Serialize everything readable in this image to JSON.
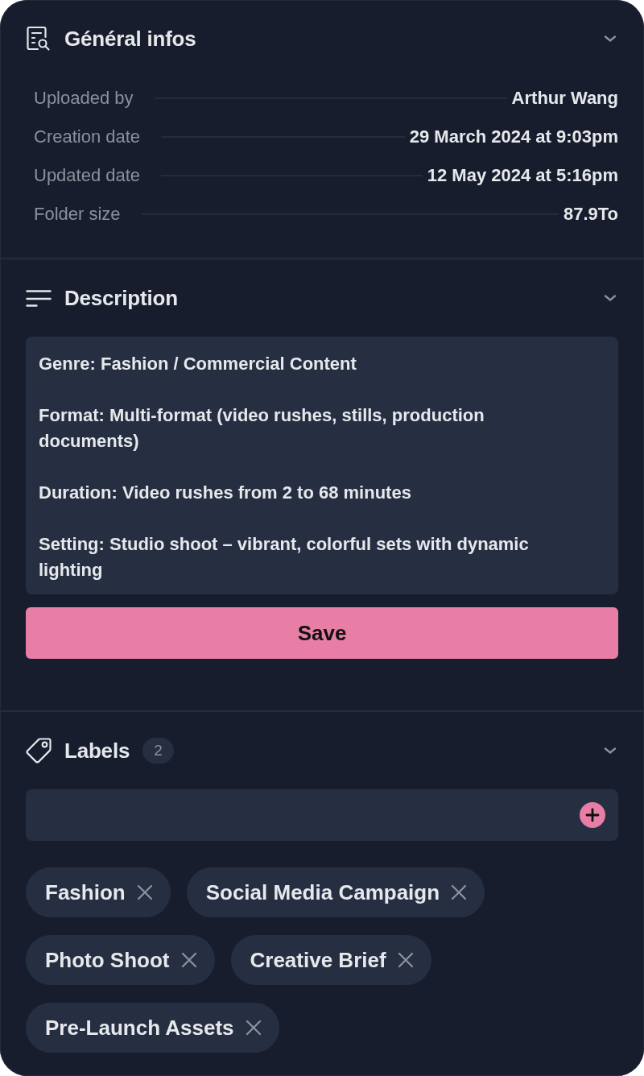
{
  "sections": [
    {
      "kind": "info",
      "title": "Général infos",
      "expanded": true,
      "rows": [
        {
          "label": "Uploaded by",
          "value": "Arthur Wang"
        },
        {
          "label": "Creation date",
          "value": "29 March 2024 at 9:03pm"
        },
        {
          "label": "Updated date",
          "value": "12 May 2024 at 5:16pm"
        },
        {
          "label": "Folder size",
          "value": "87.9To"
        }
      ]
    },
    {
      "kind": "description",
      "title": "Description",
      "expanded": true,
      "value": "Genre: Fashion / Commercial Content\n\nFormat: Multi-format (video rushes, stills, production documents)\n\nDuration: Video rushes from 2 to 68 minutes\n\nSetting: Studio shoot – vibrant, colorful sets with dynamic lighting",
      "button": "Save"
    },
    {
      "kind": "labels",
      "title": "Labels",
      "expanded": true,
      "count": "2",
      "labels": [
        "Fashion",
        "Social Media Campaign",
        "Photo Shoot",
        "Creative Brief",
        "Pre-Launch Assets"
      ]
    }
  ]
}
